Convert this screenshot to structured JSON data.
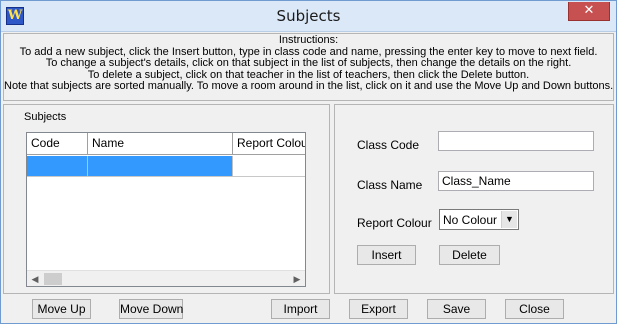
{
  "window": {
    "title": "Subjects",
    "app_icon_glyph": "W",
    "close_glyph": "✕"
  },
  "instructions": [
    "Instructions:",
    "To add a new subject, click the Insert button, type in class code and name, pressing the enter key to move to next field.",
    "To change a subject's details, click on that subject in the list of subjects, then change the details on the right.",
    "To delete a subject, click on that teacher in the list of teachers, then click the Delete button.",
    "Note that subjects are sorted manually.  To move a room around in the list, click on it and use the Move Up and Down buttons."
  ],
  "subjects": {
    "group_label": "Subjects",
    "columns": [
      "Code",
      "Name",
      "Report Colour"
    ],
    "rows": [
      {
        "code": "",
        "name": "",
        "report_colour": "",
        "selected": true
      }
    ]
  },
  "details": {
    "class_code_label": "Class Code",
    "class_code_value": "",
    "class_name_label": "Class Name",
    "class_name_value": "Class_Name",
    "report_colour_label": "Report Colour",
    "report_colour_value": "No Colour",
    "insert_label": "Insert",
    "delete_label": "Delete"
  },
  "bottom_bar": {
    "move_up": "Move Up",
    "move_down": "Move Down",
    "import": "Import",
    "export": "Export",
    "save": "Save",
    "close": "Close"
  },
  "colors": {
    "selection": "#3399ff",
    "close_button": "#c75050",
    "title_bar": "#dbe8f7"
  },
  "icons": {
    "scroll_left": "◀",
    "scroll_right": "▶",
    "dropdown": "▼"
  }
}
